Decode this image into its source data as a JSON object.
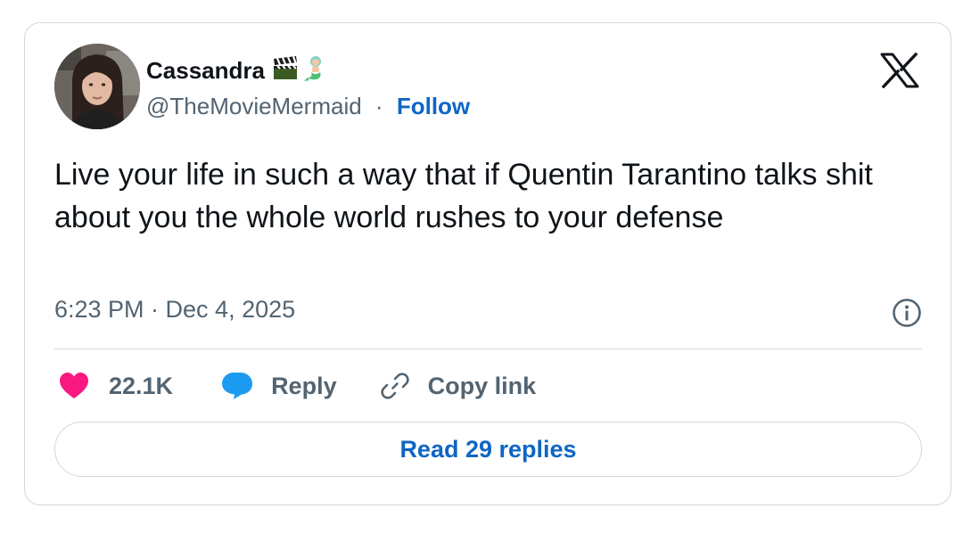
{
  "author": {
    "display_name": "Cassandra",
    "name_emojis": [
      "clapper-board-emoji",
      "merperson-emoji"
    ],
    "handle": "@TheMovieMermaid",
    "separator": "·",
    "follow_label": "Follow"
  },
  "tweet": {
    "text": "Live your life in such a way that if Quentin Tarantino talks shit about you the whole world rushes to your defense",
    "timestamp": "6:23 PM · Dec 4, 2025"
  },
  "actions": {
    "like_count": "22.1K",
    "reply_label": "Reply",
    "copy_link_label": "Copy link",
    "read_replies_label": "Read 29 replies"
  },
  "icons": {
    "brand": "x-logo-icon",
    "info": "info-icon",
    "like": "heart-icon",
    "reply": "speech-bubble-icon",
    "copy": "link-icon"
  },
  "colors": {
    "heart": "#f91880",
    "reply_bubble": "#1d9bf0",
    "link_blue": "#0f66c4",
    "text_primary": "#0f1419",
    "text_secondary": "#536471",
    "border": "#cfd9de"
  }
}
